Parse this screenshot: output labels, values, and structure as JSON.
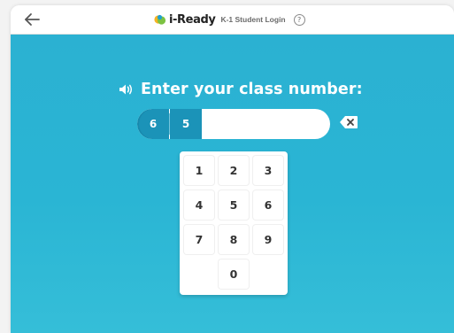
{
  "header": {
    "brand_name": "i-Ready",
    "subtitle": "K-1 Student Login",
    "help_label": "?",
    "back_icon": "arrow-left-icon",
    "logo_icon": "i-ready-logo-icon"
  },
  "login": {
    "prompt": "Enter your class number:",
    "audio_icon": "speaker-icon",
    "entered_digits": [
      "6",
      "5"
    ],
    "backspace_icon": "backspace-icon"
  },
  "keypad": {
    "keys": [
      "1",
      "2",
      "3",
      "4",
      "5",
      "6",
      "7",
      "8",
      "9",
      "0"
    ]
  },
  "colors": {
    "background": "#2bb1d2",
    "digit_fill": "#1b93b8",
    "text_on_blue": "#ffffff",
    "key_text": "#333333"
  }
}
